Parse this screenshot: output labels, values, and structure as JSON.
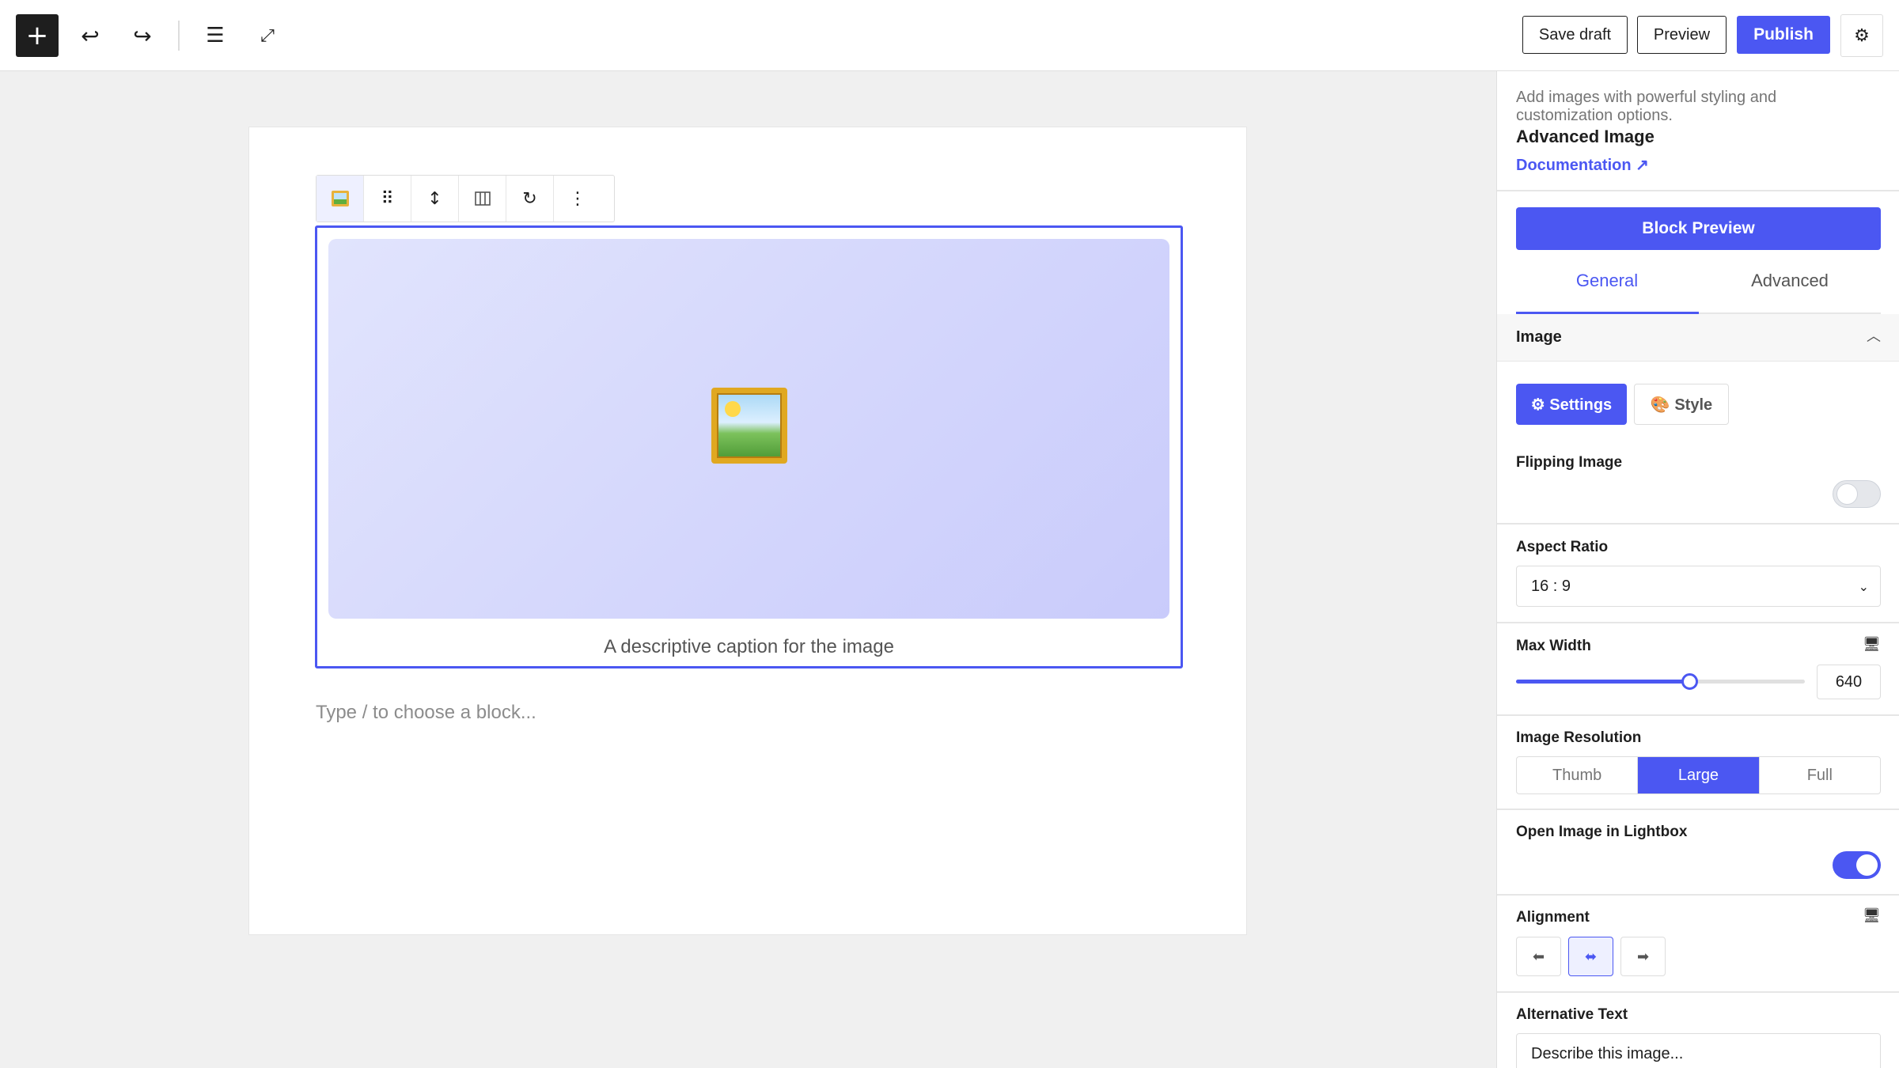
{
  "toolbar": {
    "inserter_icon": "plus-icon",
    "undo_icon": "undo-icon",
    "redo_icon": "redo-icon",
    "list_view_icon": "list-view-icon",
    "expand_icon": "expand-icon",
    "save_draft_label": "Save draft",
    "preview_label": "Preview",
    "publish_label": "Publish",
    "settings_icon": "gear-icon",
    "accent_color": "#4b57f2"
  },
  "editor": {
    "block_toolbar": [
      "image-block-icon",
      "drag-handle-icon",
      "move-up-down-icon",
      "align-icon",
      "rotate-icon",
      "more-options-icon"
    ],
    "image_caption": "A descriptive caption for the image",
    "block_placeholder": "Type / to choose a block..."
  },
  "sidebar": {
    "description": "Add images with powerful styling and customization options.",
    "block_title": "Advanced Image",
    "documentation_link": "Documentation ↗",
    "block_preview_label": "Block Preview",
    "tabs": [
      {
        "label": "General",
        "active": true
      },
      {
        "label": "Advanced",
        "active": false
      }
    ],
    "panel_title": "Image",
    "settings_tab_label": "⚙ Settings",
    "style_tab_label": "🎨 Style",
    "flipping_image_label": "Flipping Image",
    "flipping_image_enabled": false,
    "aspect_ratio_label": "Aspect Ratio",
    "aspect_ratio_value": "16 : 9",
    "max_width_label": "Max Width",
    "max_width_value": "640",
    "max_width_fraction": 0.6,
    "image_resolution_label": "Image Resolution",
    "resolution_options": [
      "Thumb",
      "Large",
      "Full"
    ],
    "resolution_selected": "Large",
    "lightbox_label": "Open Image in Lightbox",
    "lightbox_enabled": true,
    "alignment_label": "Alignment",
    "alignment_selected": "center",
    "alt_text_label": "Alternative Text",
    "alt_text_value": "Describe this image..."
  }
}
